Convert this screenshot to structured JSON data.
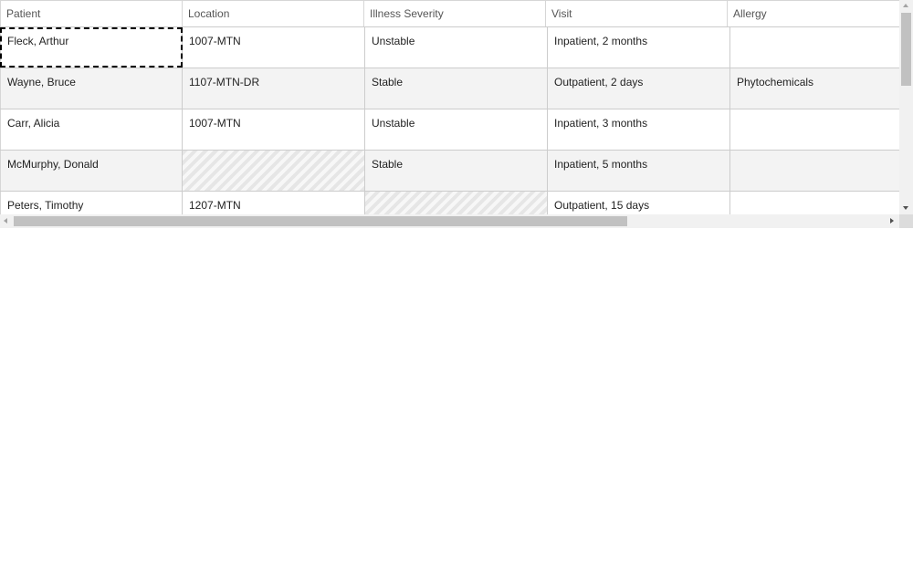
{
  "columns": [
    "Patient",
    "Location",
    "Illness Severity",
    "Visit",
    "Allergy"
  ],
  "rows": [
    {
      "patient": "Fleck, Arthur",
      "location": "1007-MTN",
      "severity": "Unstable",
      "visit": "Inpatient, 2 months",
      "allergy": ""
    },
    {
      "patient": "Wayne, Bruce",
      "location": "1107-MTN-DR",
      "severity": "Stable",
      "visit": "Outpatient, 2 days",
      "allergy": "Phytochemicals"
    },
    {
      "patient": "Carr, Alicia",
      "location": "1007-MTN",
      "severity": "Unstable",
      "visit": "Inpatient, 3 months",
      "allergy": ""
    },
    {
      "patient": "McMurphy, Donald",
      "location": "",
      "severity": "Stable",
      "visit": "Inpatient, 5 months",
      "allergy": ""
    },
    {
      "patient": "Peters, Timothy",
      "location": "1207-MTN",
      "severity": "",
      "visit": "Outpatient, 15 days",
      "allergy": ""
    }
  ]
}
